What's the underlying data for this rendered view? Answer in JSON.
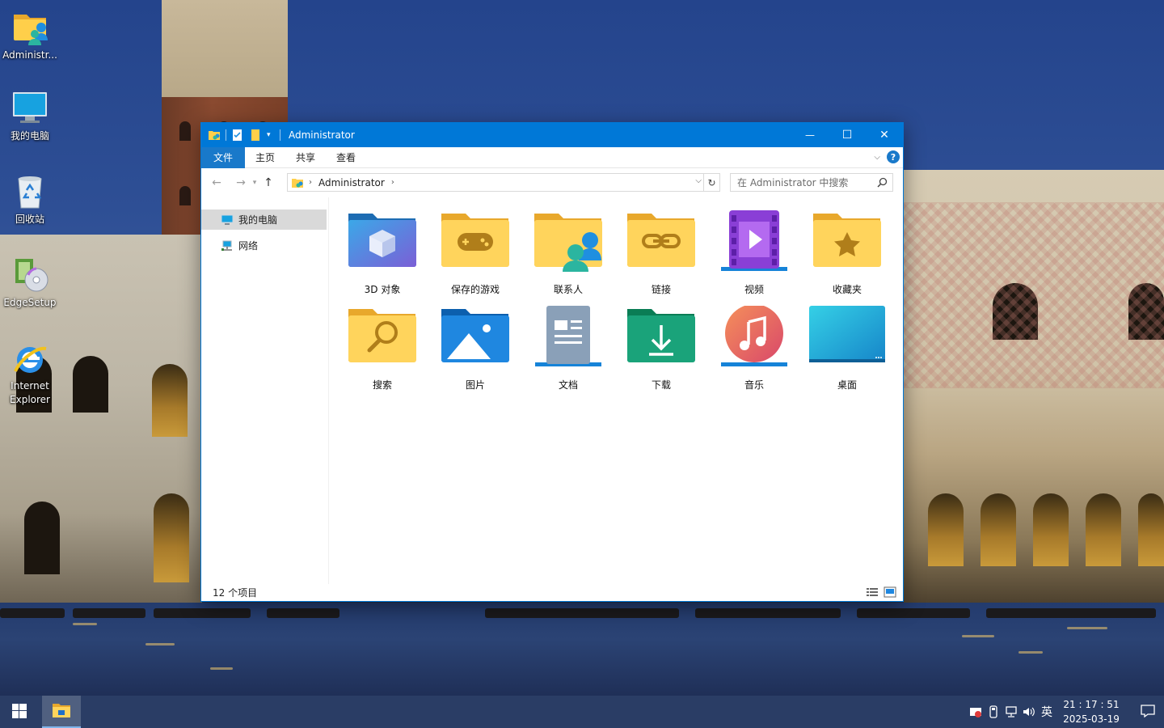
{
  "desktop": {
    "icons": [
      {
        "label": "Administr...",
        "icon": "user-folder-icon"
      },
      {
        "label": "我的电脑",
        "icon": "computer-icon"
      },
      {
        "label": "回收站",
        "icon": "recycle-bin-icon"
      },
      {
        "label": "EdgeSetup",
        "icon": "installer-icon"
      },
      {
        "label": "Internet Explorer",
        "icon": "internet-explorer-icon"
      }
    ]
  },
  "window": {
    "title": "Administrator",
    "controls": {
      "minimize": "—",
      "maximize": "☐",
      "close": "✕"
    },
    "ribbon_tabs": [
      "文件",
      "主页",
      "共享",
      "查看"
    ],
    "help": "?",
    "address": {
      "crumb": "Administrator"
    },
    "search": {
      "placeholder": "在 Administrator 中搜索"
    },
    "nav_pane": [
      {
        "label": "我的电脑",
        "icon": "computer-icon",
        "selected": true
      },
      {
        "label": "网络",
        "icon": "network-icon",
        "selected": false
      }
    ],
    "items": [
      {
        "label": "3D 对象",
        "icon": "3d-objects-folder-icon"
      },
      {
        "label": "保存的游戏",
        "icon": "saved-games-folder-icon"
      },
      {
        "label": "联系人",
        "icon": "contacts-folder-icon"
      },
      {
        "label": "链接",
        "icon": "links-folder-icon"
      },
      {
        "label": "视频",
        "icon": "videos-folder-icon"
      },
      {
        "label": "收藏夹",
        "icon": "favorites-folder-icon"
      },
      {
        "label": "搜索",
        "icon": "searches-folder-icon"
      },
      {
        "label": "图片",
        "icon": "pictures-folder-icon"
      },
      {
        "label": "文档",
        "icon": "documents-folder-icon"
      },
      {
        "label": "下载",
        "icon": "downloads-folder-icon"
      },
      {
        "label": "音乐",
        "icon": "music-folder-icon"
      },
      {
        "label": "桌面",
        "icon": "desktop-folder-icon"
      }
    ],
    "status": "12 个项目"
  },
  "taskbar": {
    "ime": "英",
    "time": "21 : 17 : 51",
    "date": "2025-03-19"
  },
  "colors": {
    "accent": "#0078d7",
    "folder_yellow": "#ffc83d",
    "taskbar": "#182c58"
  }
}
